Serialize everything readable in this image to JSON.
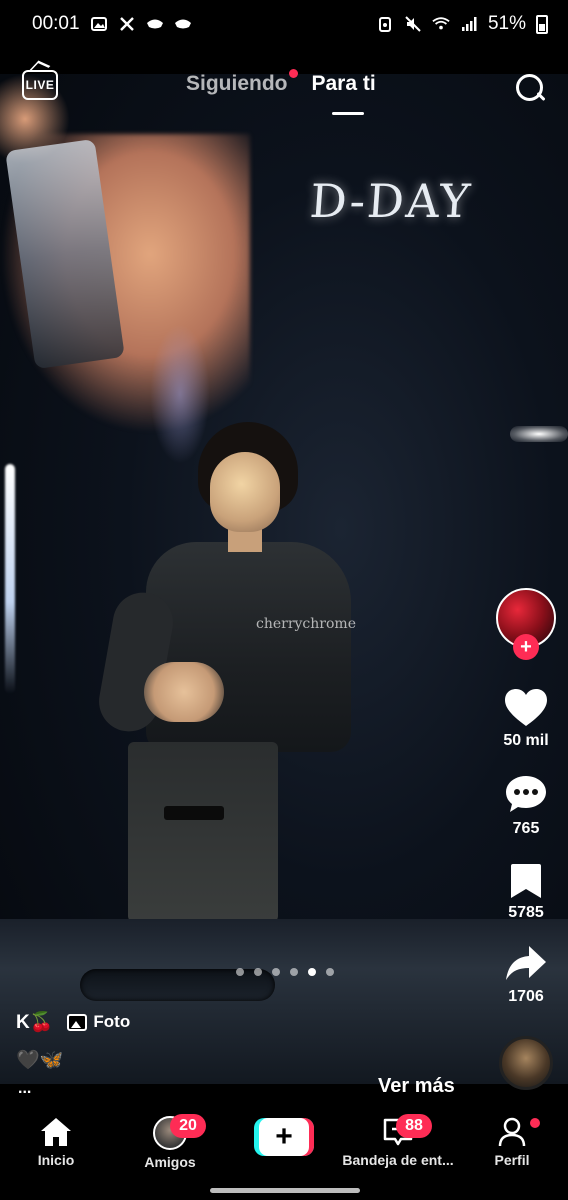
{
  "status_bar": {
    "time": "00:01",
    "battery": "51%",
    "left_icons": [
      "image-icon",
      "x-logo-icon",
      "mask-icon",
      "mask-icon"
    ],
    "right_icons": [
      "alarm-icon",
      "mute-icon",
      "wifi-icon",
      "signal-icon",
      "battery-icon"
    ]
  },
  "top_bar": {
    "live_label": "LIVE",
    "tabs": [
      {
        "label": "Siguiendo",
        "active": false,
        "has_dot": true
      },
      {
        "label": "Para ti",
        "active": true,
        "has_dot": false
      }
    ]
  },
  "video": {
    "screen_text": "D-DAY",
    "watermark": "cherrychrome",
    "pager_total": 6,
    "pager_active_index": 4
  },
  "actions": {
    "likes": "50 mil",
    "comments": "765",
    "bookmarks": "5785",
    "shares": "1706"
  },
  "post": {
    "author": "K🍒",
    "type_label": "Foto",
    "caption": "🖤🦋",
    "ellipsis": "...",
    "more_label": "Ver más"
  },
  "nav": {
    "home": "Inicio",
    "friends": "Amigos",
    "friends_badge": "20",
    "inbox": "Bandeja de ent...",
    "inbox_badge": "88",
    "profile": "Perfil",
    "create_symbol": "+"
  },
  "colors": {
    "accent_red": "#fe2c55",
    "accent_cyan": "#25f4ee",
    "background": "#000000"
  }
}
